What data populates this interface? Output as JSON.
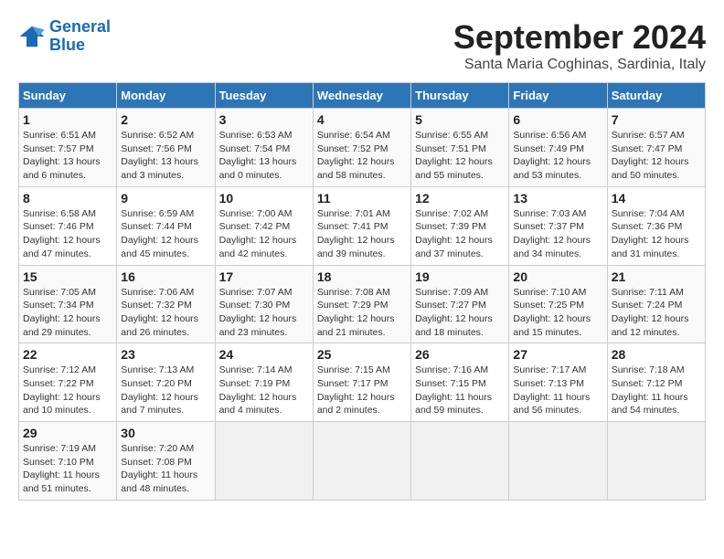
{
  "logo": {
    "line1": "General",
    "line2": "Blue"
  },
  "title": "September 2024",
  "subtitle": "Santa Maria Coghinas, Sardinia, Italy",
  "days_of_week": [
    "Sunday",
    "Monday",
    "Tuesday",
    "Wednesday",
    "Thursday",
    "Friday",
    "Saturday"
  ],
  "weeks": [
    [
      {
        "day": "1",
        "info": "Sunrise: 6:51 AM\nSunset: 7:57 PM\nDaylight: 13 hours\nand 6 minutes."
      },
      {
        "day": "2",
        "info": "Sunrise: 6:52 AM\nSunset: 7:56 PM\nDaylight: 13 hours\nand 3 minutes."
      },
      {
        "day": "3",
        "info": "Sunrise: 6:53 AM\nSunset: 7:54 PM\nDaylight: 13 hours\nand 0 minutes."
      },
      {
        "day": "4",
        "info": "Sunrise: 6:54 AM\nSunset: 7:52 PM\nDaylight: 12 hours\nand 58 minutes."
      },
      {
        "day": "5",
        "info": "Sunrise: 6:55 AM\nSunset: 7:51 PM\nDaylight: 12 hours\nand 55 minutes."
      },
      {
        "day": "6",
        "info": "Sunrise: 6:56 AM\nSunset: 7:49 PM\nDaylight: 12 hours\nand 53 minutes."
      },
      {
        "day": "7",
        "info": "Sunrise: 6:57 AM\nSunset: 7:47 PM\nDaylight: 12 hours\nand 50 minutes."
      }
    ],
    [
      {
        "day": "8",
        "info": "Sunrise: 6:58 AM\nSunset: 7:46 PM\nDaylight: 12 hours\nand 47 minutes."
      },
      {
        "day": "9",
        "info": "Sunrise: 6:59 AM\nSunset: 7:44 PM\nDaylight: 12 hours\nand 45 minutes."
      },
      {
        "day": "10",
        "info": "Sunrise: 7:00 AM\nSunset: 7:42 PM\nDaylight: 12 hours\nand 42 minutes."
      },
      {
        "day": "11",
        "info": "Sunrise: 7:01 AM\nSunset: 7:41 PM\nDaylight: 12 hours\nand 39 minutes."
      },
      {
        "day": "12",
        "info": "Sunrise: 7:02 AM\nSunset: 7:39 PM\nDaylight: 12 hours\nand 37 minutes."
      },
      {
        "day": "13",
        "info": "Sunrise: 7:03 AM\nSunset: 7:37 PM\nDaylight: 12 hours\nand 34 minutes."
      },
      {
        "day": "14",
        "info": "Sunrise: 7:04 AM\nSunset: 7:36 PM\nDaylight: 12 hours\nand 31 minutes."
      }
    ],
    [
      {
        "day": "15",
        "info": "Sunrise: 7:05 AM\nSunset: 7:34 PM\nDaylight: 12 hours\nand 29 minutes."
      },
      {
        "day": "16",
        "info": "Sunrise: 7:06 AM\nSunset: 7:32 PM\nDaylight: 12 hours\nand 26 minutes."
      },
      {
        "day": "17",
        "info": "Sunrise: 7:07 AM\nSunset: 7:30 PM\nDaylight: 12 hours\nand 23 minutes."
      },
      {
        "day": "18",
        "info": "Sunrise: 7:08 AM\nSunset: 7:29 PM\nDaylight: 12 hours\nand 21 minutes."
      },
      {
        "day": "19",
        "info": "Sunrise: 7:09 AM\nSunset: 7:27 PM\nDaylight: 12 hours\nand 18 minutes."
      },
      {
        "day": "20",
        "info": "Sunrise: 7:10 AM\nSunset: 7:25 PM\nDaylight: 12 hours\nand 15 minutes."
      },
      {
        "day": "21",
        "info": "Sunrise: 7:11 AM\nSunset: 7:24 PM\nDaylight: 12 hours\nand 12 minutes."
      }
    ],
    [
      {
        "day": "22",
        "info": "Sunrise: 7:12 AM\nSunset: 7:22 PM\nDaylight: 12 hours\nand 10 minutes."
      },
      {
        "day": "23",
        "info": "Sunrise: 7:13 AM\nSunset: 7:20 PM\nDaylight: 12 hours\nand 7 minutes."
      },
      {
        "day": "24",
        "info": "Sunrise: 7:14 AM\nSunset: 7:19 PM\nDaylight: 12 hours\nand 4 minutes."
      },
      {
        "day": "25",
        "info": "Sunrise: 7:15 AM\nSunset: 7:17 PM\nDaylight: 12 hours\nand 2 minutes."
      },
      {
        "day": "26",
        "info": "Sunrise: 7:16 AM\nSunset: 7:15 PM\nDaylight: 11 hours\nand 59 minutes."
      },
      {
        "day": "27",
        "info": "Sunrise: 7:17 AM\nSunset: 7:13 PM\nDaylight: 11 hours\nand 56 minutes."
      },
      {
        "day": "28",
        "info": "Sunrise: 7:18 AM\nSunset: 7:12 PM\nDaylight: 11 hours\nand 54 minutes."
      }
    ],
    [
      {
        "day": "29",
        "info": "Sunrise: 7:19 AM\nSunset: 7:10 PM\nDaylight: 11 hours\nand 51 minutes."
      },
      {
        "day": "30",
        "info": "Sunrise: 7:20 AM\nSunset: 7:08 PM\nDaylight: 11 hours\nand 48 minutes."
      },
      {
        "day": "",
        "info": ""
      },
      {
        "day": "",
        "info": ""
      },
      {
        "day": "",
        "info": ""
      },
      {
        "day": "",
        "info": ""
      },
      {
        "day": "",
        "info": ""
      }
    ]
  ]
}
